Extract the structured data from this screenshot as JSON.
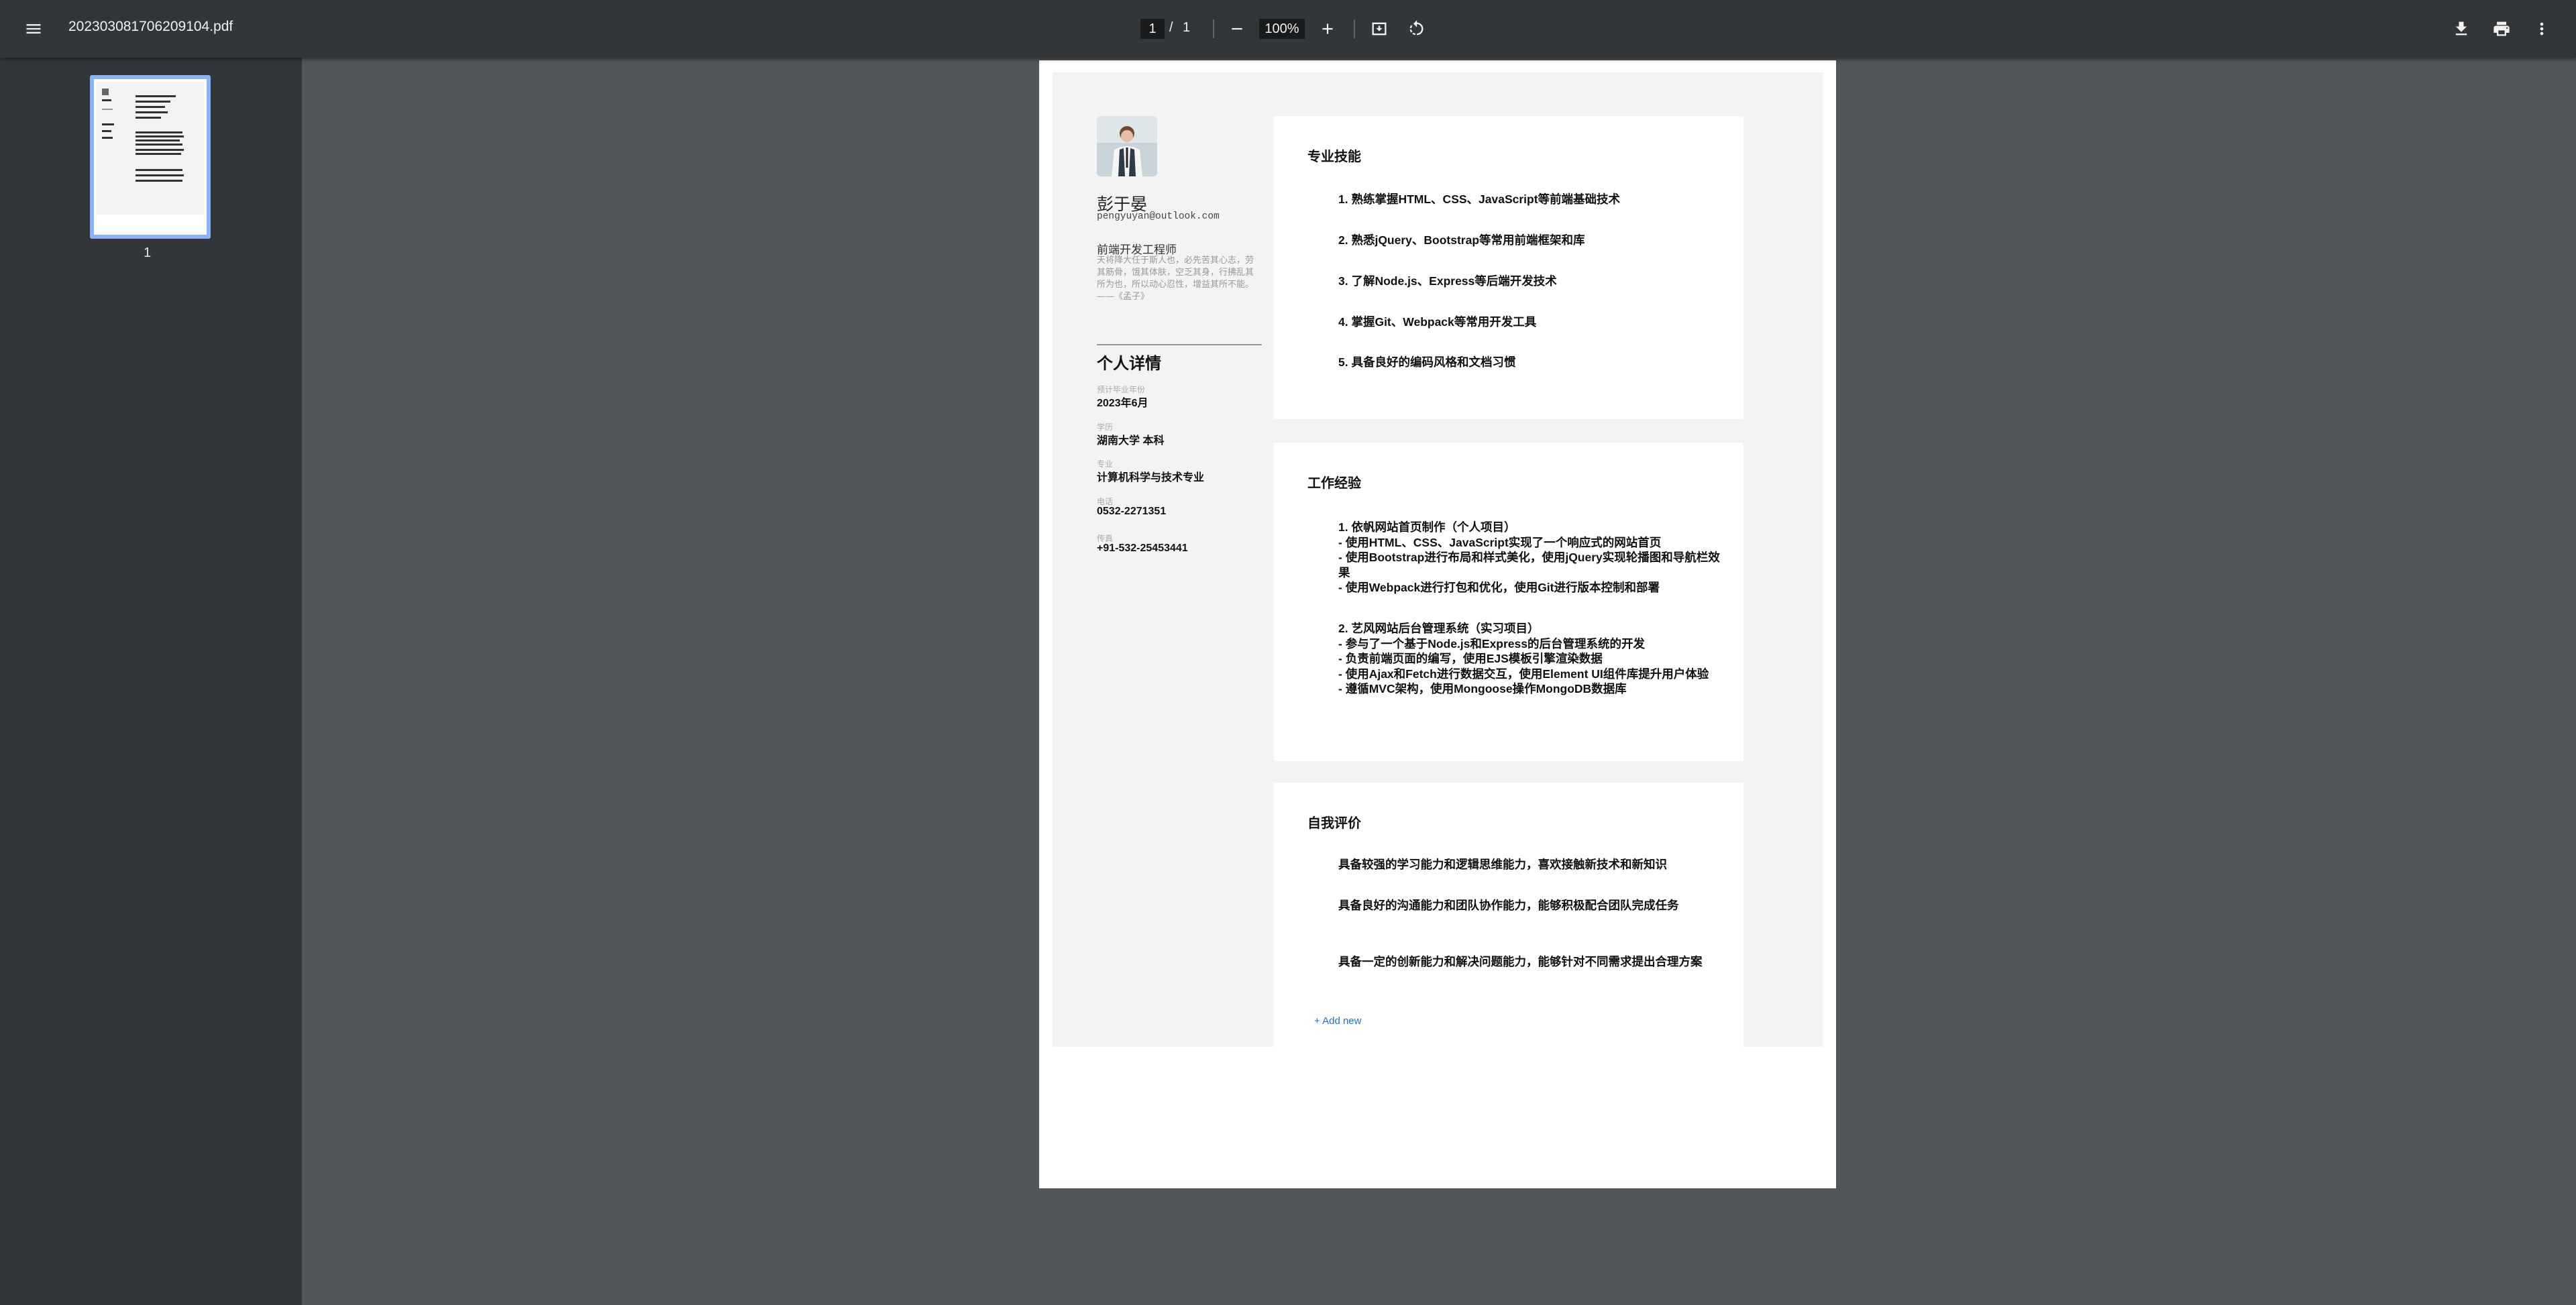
{
  "toolbar": {
    "file_name": "20230308170620910​4.pdf",
    "current_page": "1",
    "page_separator": "/",
    "total_pages": "1",
    "zoom": "100%"
  },
  "sidebar": {
    "thumbnail_label": "1"
  },
  "resume": {
    "name": "彭于晏",
    "email": "pengyuyan@outlook.com",
    "job_title": "前端开发工程师",
    "quote": "天将降大任于斯人也，必先苦其心志，劳其筋骨，饿其体肤，空乏其身，行拂乱其所为也，所以动心忍性，增益其所不能。——《孟子》",
    "details_title": "个人详情",
    "details": [
      {
        "label": "预计毕业年份",
        "value": "2023年6月"
      },
      {
        "label": "学历",
        "value": "湖南大学 本科"
      },
      {
        "label": "专业",
        "value": "计算机科学与技术专业"
      },
      {
        "label": "电话",
        "value": "0532-2271351"
      },
      {
        "label": "传真",
        "value": "+91-532-25453441"
      }
    ],
    "skills": {
      "title": "专业技能",
      "items": [
        "1. 熟练掌握HTML、CSS、JavaScript等前端基础技术",
        "2. 熟悉jQuery、Bootstrap等常用前端框架和库",
        "3. 了解Node.js、Express等后端开发技术",
        "4. 掌握Git、Webpack等常用开发工具",
        "5. 具备良好的编码风格和文档习惯"
      ]
    },
    "work": {
      "title": "工作经验",
      "items": [
        "1. 依帆网站首页制作（个人项目）\n- 使用HTML、CSS、JavaScript实现了一个响应式的网站首页\n- 使用Bootstrap进行布局和样式美化，使用jQuery实现轮播图和导航栏效果\n- 使用Webpack进行打包和优化，使用Git进行版本控制和部署",
        "2. 艺风网站后台管理系统（实习项目）\n- 参与了一个基于Node.js和Express的后台管理系统的开发\n- 负责前端页面的编写，使用EJS模板引擎渲染数据\n- 使用Ajax和Fetch进行数据交互，使用Element UI组件库提升用户体验\n- 遵循MVC架构，使用Mongoose操作MongoDB数据库"
      ]
    },
    "evaluation": {
      "title": "自我评价",
      "items": [
        "具备较强的学习能力和逻辑思维能力，喜欢接触新技术和新知识",
        "具备良好的沟通能力和团队协作能力，能够积极配合团队完成任务",
        "具备一定的创新能力和解决问题能力，能够针对不同需求提出合理方案"
      ],
      "add_new": "+ Add new"
    }
  }
}
